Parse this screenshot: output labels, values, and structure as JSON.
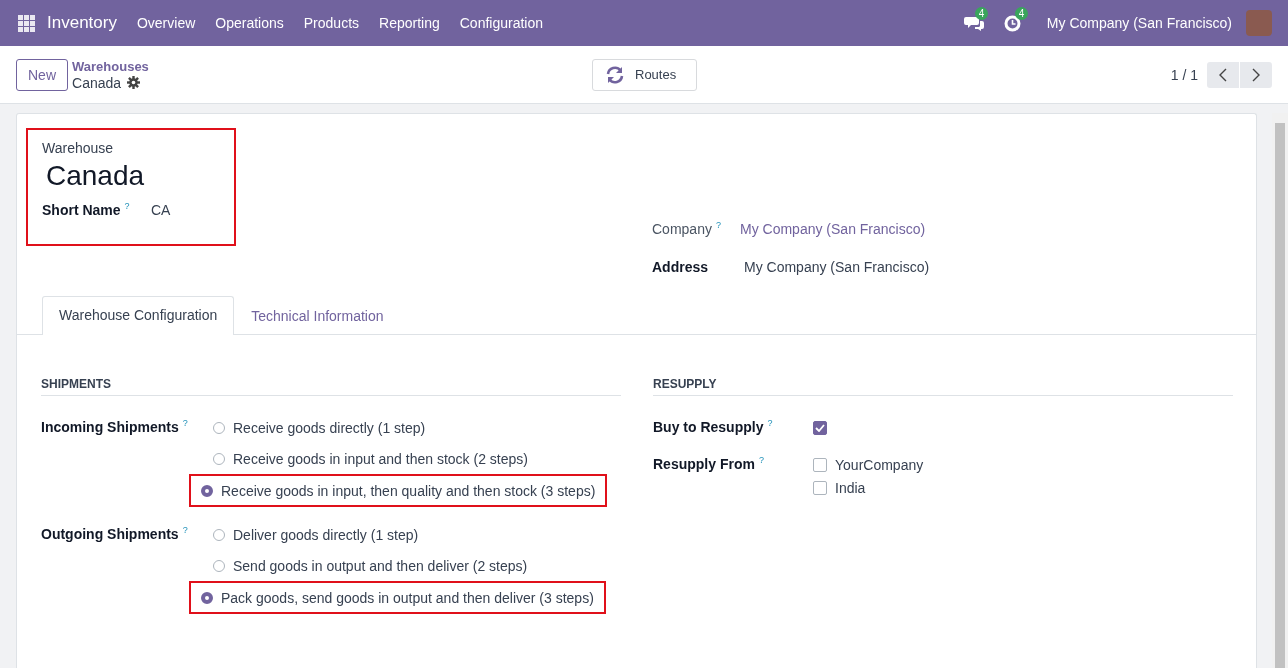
{
  "navbar": {
    "app": "Inventory",
    "menu": [
      "Overview",
      "Operations",
      "Products",
      "Reporting",
      "Configuration"
    ],
    "messages_count": "4",
    "activities_count": "4",
    "company": "My Company (San Francisco)"
  },
  "control_panel": {
    "new_button": "New",
    "breadcrumb": "Warehouses",
    "record": "Canada",
    "action_button": "Routes",
    "pager": "1 / 1"
  },
  "form": {
    "highlighted": true,
    "name_label": "Warehouse",
    "name": "Canada",
    "short_name_label": "Short Name",
    "short_name_help": "?",
    "short_name": "CA",
    "company_label": "Company",
    "company_help": "?",
    "company": "My Company (San Francisco)",
    "address_label": "Address",
    "address": "My Company (San Francisco)"
  },
  "tabs": [
    {
      "label": "Warehouse Configuration",
      "selected": true
    },
    {
      "label": "Technical Information",
      "selected": false
    }
  ],
  "shipments": {
    "title": "SHIPMENTS",
    "groups": [
      {
        "label": "Incoming Shipments",
        "help": "?",
        "options": [
          {
            "label": "Receive goods directly (1 step)",
            "selected": false,
            "highlighted": false
          },
          {
            "label": "Receive goods in input and then stock (2 steps)",
            "selected": false,
            "highlighted": false
          },
          {
            "label": "Receive goods in input, then quality and then stock (3 steps)",
            "selected": true,
            "highlighted": true
          }
        ]
      },
      {
        "label": "Outgoing Shipments",
        "help": "?",
        "options": [
          {
            "label": "Deliver goods directly (1 step)",
            "selected": false,
            "highlighted": false
          },
          {
            "label": "Send goods in output and then deliver (2 steps)",
            "selected": false,
            "highlighted": false
          },
          {
            "label": "Pack goods, send goods in output and then deliver (3 steps)",
            "selected": true,
            "highlighted": true
          }
        ]
      }
    ]
  },
  "resupply": {
    "title": "RESUPPLY",
    "buy_label": "Buy to Resupply",
    "buy_help": "?",
    "buy_checked": true,
    "from_label": "Resupply From",
    "from_help": "?",
    "from_options": [
      {
        "label": "YourCompany",
        "checked": false
      },
      {
        "label": "India",
        "checked": false
      }
    ]
  }
}
